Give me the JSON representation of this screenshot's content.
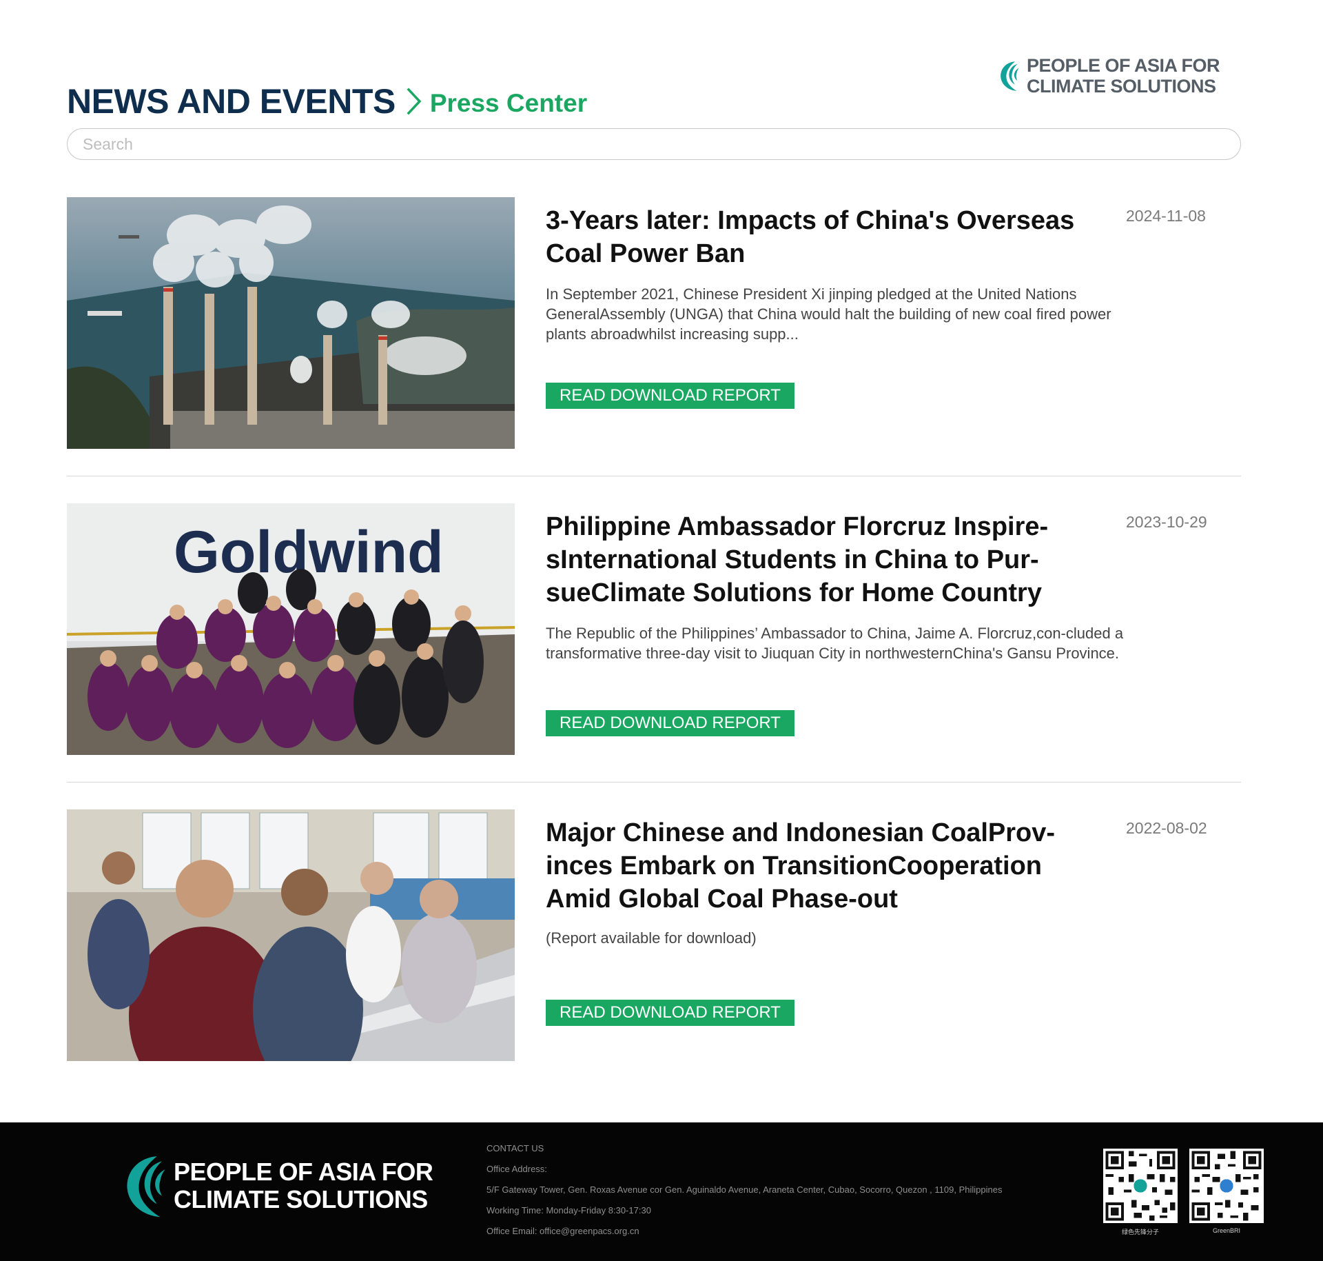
{
  "brand": {
    "name_line1": "PEOPLE OF ASIA FOR",
    "name_line2": "CLIMATE SOLUTIONS",
    "logo_icon": "wave-logo-icon",
    "teal": "#13a29a"
  },
  "header": {
    "title": "NEWS AND EVENTS",
    "separator_icon": "chevron-right-icon",
    "subtitle": "Press Center"
  },
  "search": {
    "placeholder": "Search",
    "value": ""
  },
  "articles": [
    {
      "title": "3-Years later: Impacts of China's Overseas Coal Power Ban",
      "date": "2024-11-08",
      "summary": "In September 2021, Chinese President Xi jinping pledged at the United Nations GeneralAssembly (UNGA) that China would halt the building of new coal fired power plants abroadwhilst increasing supp...",
      "button": "READ DOWNLOAD REPORT",
      "image": "coal-power-plant-aerial-photo"
    },
    {
      "title": "Philippine Ambassador Florcruz Inspire-sInternational Students in China to Pur-sueClimate Solutions for Home Country",
      "date": "2023-10-29",
      "summary": "The Republic of the Philippines’ Ambassador to China, Jaime A. Florcruz,con-cluded a transformative three-day visit to Jiuquan City in northwesternChina's Gansu Province.",
      "button": "READ DOWNLOAD REPORT",
      "image": "group-photo-goldwind",
      "image_text": "Goldwind"
    },
    {
      "title": "Major Chinese and Indonesian CoalProv-inces Embark on TransitionCooperation Amid Global Coal Phase-out",
      "date": "2022-08-02",
      "summary": "(Report available for download)",
      "button": "READ DOWNLOAD REPORT",
      "image": "delegation-visit-photo"
    }
  ],
  "footer": {
    "contact_heading": "CONTACT US",
    "address_label": "Office Address:",
    "address": "5/F Gateway Tower, Gen. Roxas Avenue cor Gen. Aguinaldo Avenue, Araneta Center, Cubao, Socorro, Quezon , 1109, Philippines",
    "working_time": "Working Time: Monday-Friday 8:30-17:30",
    "email": "Office Email: office@greenpacs.org.cn",
    "qr_codes": [
      {
        "caption": "绿色先锋分子",
        "icon": "qr-code-icon"
      },
      {
        "caption": "GreenBRI",
        "icon": "qr-code-icon"
      }
    ]
  },
  "colors": {
    "navy": "#0f2e4e",
    "green": "#1aa761",
    "footer_bg": "#050505"
  }
}
